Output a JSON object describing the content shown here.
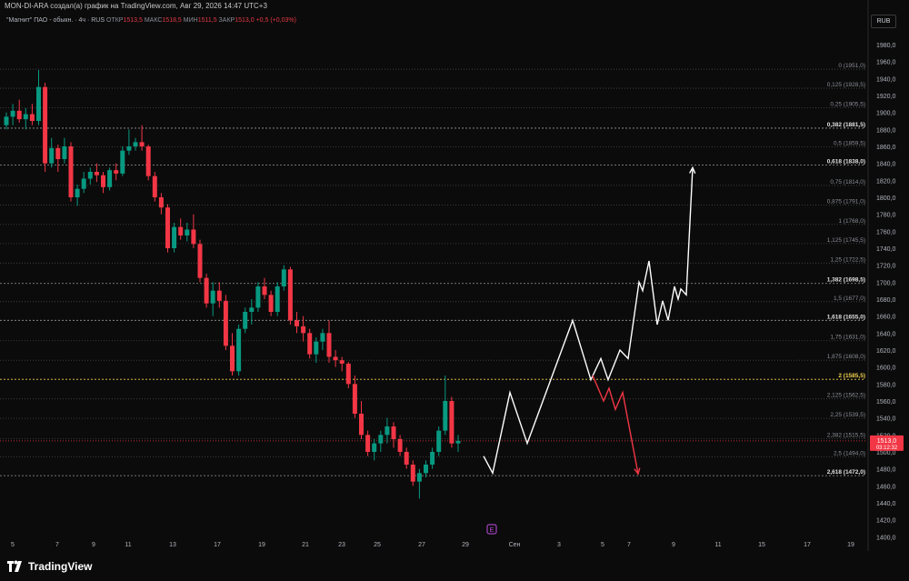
{
  "header": {
    "title": "MON-DI-ARA создал(а) график на TradingView.com, Авг 29, 2026 14:47 UTC+3"
  },
  "legend": {
    "symbol": "\"Магнит\" ПАО - обыкн. · 4ч · RUS",
    "open_label": "ОТКР",
    "open": "1513,5",
    "high_label": "МАКС",
    "high": "1518,5",
    "low_label": "МИН",
    "low": "1511,5",
    "close_label": "ЗАКР",
    "close": "1513,0",
    "change": "+0,5 (+0,03%)"
  },
  "currency": "RUB",
  "price_tag": {
    "price": "1513,0",
    "timer": "03:12:32"
  },
  "earnings_marker": "E",
  "brand": {
    "name": "TradingView"
  },
  "colors": {
    "bg": "#0b0b0b",
    "up": "#089981",
    "down": "#f23645",
    "projection_up": "#ffffff",
    "projection_down": "#f23645",
    "fib_highlight": "#f0d050"
  },
  "chart_data": {
    "type": "candlestick",
    "ylim": [
      1395,
      1995
    ],
    "y_ticks": [
      1400,
      1420,
      1440,
      1460,
      1480,
      1500,
      1520,
      1540,
      1560,
      1580,
      1600,
      1620,
      1640,
      1660,
      1680,
      1700,
      1720,
      1740,
      1760,
      1780,
      1800,
      1820,
      1840,
      1860,
      1880,
      1900,
      1920,
      1940,
      1960,
      1980
    ],
    "x_labels": [
      "5",
      "7",
      "9",
      "11",
      "13",
      "17",
      "19",
      "21",
      "23",
      "25",
      "27",
      "29",
      "Сен",
      "3",
      "5",
      "7",
      "9",
      "11",
      "15",
      "17",
      "19"
    ],
    "fib_levels": [
      {
        "label": "0 (1951,0)",
        "value": 1951.0,
        "strong": false
      },
      {
        "label": "0,125 (1928,5)",
        "value": 1928.5,
        "strong": false
      },
      {
        "label": "0,25 (1905,5)",
        "value": 1905.5,
        "strong": false
      },
      {
        "label": "0,382 (1881,5)",
        "value": 1881.5,
        "strong": true
      },
      {
        "label": "0,5 (1859,5)",
        "value": 1859.5,
        "strong": false
      },
      {
        "label": "0,618 (1838,0)",
        "value": 1838.0,
        "strong": true
      },
      {
        "label": "0,75 (1814,0)",
        "value": 1814.0,
        "strong": false
      },
      {
        "label": "0,875 (1791,0)",
        "value": 1791.0,
        "strong": false
      },
      {
        "label": "1 (1768,0)",
        "value": 1768.0,
        "strong": false
      },
      {
        "label": "1,125 (1745,5)",
        "value": 1745.5,
        "strong": false
      },
      {
        "label": "1,25 (1722,5)",
        "value": 1722.5,
        "strong": false
      },
      {
        "label": "1,382 (1698,5)",
        "value": 1698.5,
        "strong": true
      },
      {
        "label": "1,5 (1677,0)",
        "value": 1677.0,
        "strong": false
      },
      {
        "label": "1,618 (1655,0)",
        "value": 1655.0,
        "strong": true
      },
      {
        "label": "1,75 (1631,0)",
        "value": 1631.0,
        "strong": false
      },
      {
        "label": "1,875 (1608,0)",
        "value": 1608.0,
        "strong": false
      },
      {
        "label": "2 (1585,5)",
        "value": 1585.5,
        "strong": true,
        "highlight": true
      },
      {
        "label": "2,125 (1562,5)",
        "value": 1562.5,
        "strong": false
      },
      {
        "label": "2,25 (1539,5)",
        "value": 1539.5,
        "strong": false
      },
      {
        "label": "2,382 (1515,5)",
        "value": 1515.5,
        "strong": false
      },
      {
        "label": "2,5 (1494,0)",
        "value": 1494.0,
        "strong": false
      },
      {
        "label": "2,618 (1472,0)",
        "value": 1472.0,
        "strong": true
      }
    ],
    "candles": [
      [
        1885,
        1900,
        1880,
        1895
      ],
      [
        1895,
        1910,
        1885,
        1902
      ],
      [
        1902,
        1915,
        1888,
        1892
      ],
      [
        1892,
        1905,
        1880,
        1898
      ],
      [
        1898,
        1910,
        1885,
        1890
      ],
      [
        1890,
        1950,
        1885,
        1930
      ],
      [
        1930,
        1935,
        1830,
        1840
      ],
      [
        1840,
        1870,
        1835,
        1858
      ],
      [
        1858,
        1862,
        1830,
        1845
      ],
      [
        1845,
        1870,
        1840,
        1860
      ],
      [
        1860,
        1865,
        1795,
        1800
      ],
      [
        1800,
        1815,
        1790,
        1810
      ],
      [
        1810,
        1830,
        1805,
        1822
      ],
      [
        1822,
        1835,
        1815,
        1830
      ],
      [
        1830,
        1840,
        1818,
        1826
      ],
      [
        1826,
        1830,
        1805,
        1812
      ],
      [
        1812,
        1835,
        1808,
        1832
      ],
      [
        1832,
        1840,
        1820,
        1828
      ],
      [
        1828,
        1860,
        1825,
        1855
      ],
      [
        1855,
        1880,
        1850,
        1860
      ],
      [
        1860,
        1870,
        1855,
        1865
      ],
      [
        1865,
        1885,
        1855,
        1860
      ],
      [
        1860,
        1862,
        1820,
        1825
      ],
      [
        1825,
        1830,
        1795,
        1800
      ],
      [
        1800,
        1805,
        1780,
        1788
      ],
      [
        1788,
        1792,
        1735,
        1740
      ],
      [
        1740,
        1770,
        1735,
        1765
      ],
      [
        1765,
        1775,
        1750,
        1755
      ],
      [
        1755,
        1770,
        1748,
        1762
      ],
      [
        1762,
        1780,
        1740,
        1745
      ],
      [
        1745,
        1750,
        1700,
        1705
      ],
      [
        1705,
        1710,
        1670,
        1675
      ],
      [
        1675,
        1700,
        1660,
        1690
      ],
      [
        1690,
        1700,
        1670,
        1678
      ],
      [
        1678,
        1685,
        1620,
        1625
      ],
      [
        1625,
        1640,
        1590,
        1595
      ],
      [
        1595,
        1650,
        1590,
        1645
      ],
      [
        1645,
        1670,
        1640,
        1665
      ],
      [
        1665,
        1680,
        1650,
        1670
      ],
      [
        1670,
        1700,
        1665,
        1695
      ],
      [
        1695,
        1705,
        1680,
        1685
      ],
      [
        1685,
        1690,
        1660,
        1665
      ],
      [
        1665,
        1700,
        1660,
        1695
      ],
      [
        1695,
        1720,
        1690,
        1715
      ],
      [
        1715,
        1718,
        1650,
        1655
      ],
      [
        1655,
        1665,
        1640,
        1648
      ],
      [
        1648,
        1660,
        1630,
        1640
      ],
      [
        1640,
        1645,
        1610,
        1615
      ],
      [
        1615,
        1635,
        1605,
        1630
      ],
      [
        1630,
        1645,
        1620,
        1640
      ],
      [
        1640,
        1655,
        1605,
        1612
      ],
      [
        1612,
        1620,
        1600,
        1608
      ],
      [
        1608,
        1612,
        1595,
        1604
      ],
      [
        1604,
        1606,
        1575,
        1580
      ],
      [
        1580,
        1590,
        1540,
        1545
      ],
      [
        1545,
        1560,
        1515,
        1520
      ],
      [
        1520,
        1525,
        1495,
        1500
      ],
      [
        1500,
        1515,
        1490,
        1510
      ],
      [
        1510,
        1525,
        1500,
        1520
      ],
      [
        1520,
        1540,
        1510,
        1530
      ],
      [
        1530,
        1535,
        1505,
        1515
      ],
      [
        1515,
        1520,
        1495,
        1500
      ],
      [
        1500,
        1505,
        1480,
        1485
      ],
      [
        1485,
        1490,
        1460,
        1465
      ],
      [
        1465,
        1480,
        1445,
        1475
      ],
      [
        1475,
        1490,
        1470,
        1485
      ],
      [
        1485,
        1505,
        1480,
        1500
      ],
      [
        1500,
        1530,
        1495,
        1525
      ],
      [
        1525,
        1590,
        1520,
        1560
      ],
      [
        1560,
        1565,
        1505,
        1510
      ],
      [
        1510,
        1520,
        1500,
        1513
      ]
    ],
    "projection_up": [
      [
        0,
        1495
      ],
      [
        10,
        1475
      ],
      [
        29,
        1570
      ],
      [
        48,
        1510
      ],
      [
        98,
        1655
      ],
      [
        118,
        1585
      ],
      [
        129,
        1610
      ],
      [
        137,
        1585
      ],
      [
        150,
        1620
      ],
      [
        159,
        1610
      ],
      [
        171,
        1700
      ],
      [
        175,
        1690
      ],
      [
        182,
        1725
      ],
      [
        191,
        1650
      ],
      [
        197,
        1678
      ],
      [
        203,
        1655
      ],
      [
        210,
        1695
      ],
      [
        214,
        1680
      ],
      [
        217,
        1692
      ],
      [
        223,
        1685
      ],
      [
        230,
        1835
      ]
    ],
    "projection_down": [
      [
        120,
        1590
      ],
      [
        132,
        1560
      ],
      [
        138,
        1575
      ],
      [
        145,
        1550
      ],
      [
        153,
        1570
      ],
      [
        170,
        1474
      ]
    ]
  }
}
